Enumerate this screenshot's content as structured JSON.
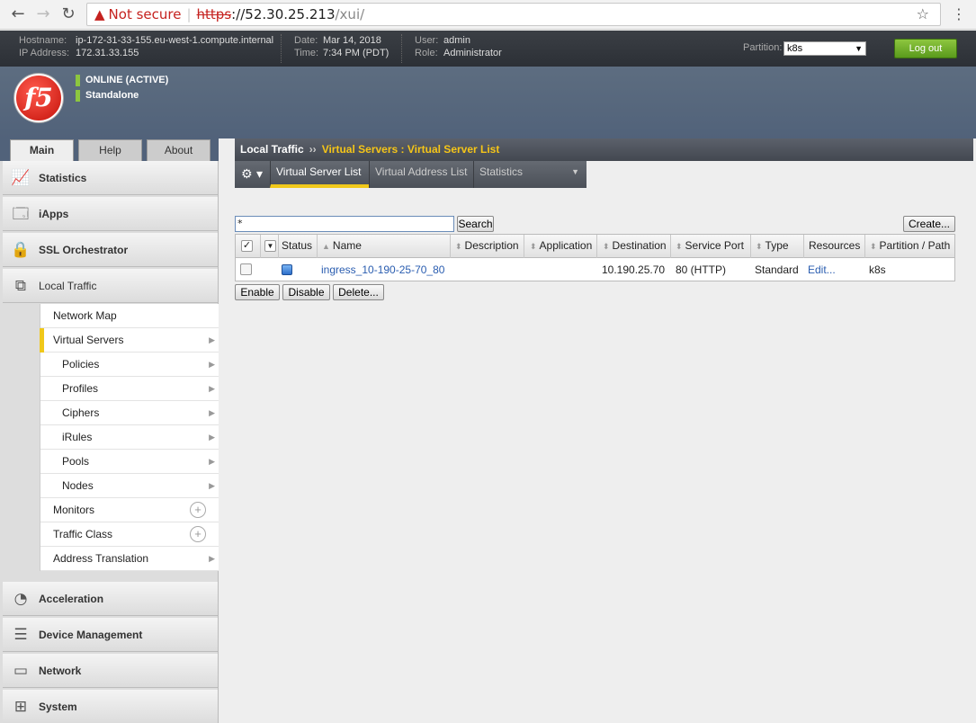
{
  "browser": {
    "not_secure": "Not secure",
    "scheme": "https",
    "host": "://52.30.25.213",
    "path": "/xui/"
  },
  "header": {
    "hostname_label": "Hostname:",
    "hostname": "ip-172-31-33-155.eu-west-1.compute.internal",
    "ip_label": "IP Address:",
    "ip": "172.31.33.155",
    "date_label": "Date:",
    "date": "Mar 14, 2018",
    "time_label": "Time:",
    "time": "7:34 PM (PDT)",
    "user_label": "User:",
    "user": "admin",
    "role_label": "Role:",
    "role": "Administrator",
    "partition_label": "Partition:",
    "partition": "k8s",
    "logout": "Log out"
  },
  "status": {
    "online": "ONLINE (ACTIVE)",
    "mode": "Standalone",
    "logo_text": "f5"
  },
  "main_tabs": [
    "Main",
    "Help",
    "About"
  ],
  "sidebar": {
    "sections": [
      "Statistics",
      "iApps",
      "SSL Orchestrator",
      "Local Traffic",
      "Acceleration",
      "Device Management",
      "Network",
      "System"
    ],
    "local_traffic_items": [
      "Network Map",
      "Virtual Servers",
      "Policies",
      "Profiles",
      "Ciphers",
      "iRules",
      "Pools",
      "Nodes",
      "Monitors",
      "Traffic Class",
      "Address Translation"
    ]
  },
  "breadcrumb": {
    "section": "Local Traffic",
    "sep": "››",
    "page": "Virtual Servers : Virtual Server List"
  },
  "content_tabs": [
    "Virtual Server List",
    "Virtual Address List",
    "Statistics"
  ],
  "filter": {
    "value": "*",
    "search": "Search",
    "create": "Create..."
  },
  "table": {
    "columns": [
      "Status",
      "Name",
      "Description",
      "Application",
      "Destination",
      "Service Port",
      "Type",
      "Resources",
      "Partition / Path"
    ],
    "rows": [
      {
        "name": "ingress_10-190-25-70_80",
        "description": "",
        "application": "",
        "destination": "10.190.25.70",
        "service_port": "80 (HTTP)",
        "type": "Standard",
        "resources": "Edit...",
        "partition": "k8s"
      }
    ]
  },
  "actions": [
    "Enable",
    "Disable",
    "Delete..."
  ]
}
